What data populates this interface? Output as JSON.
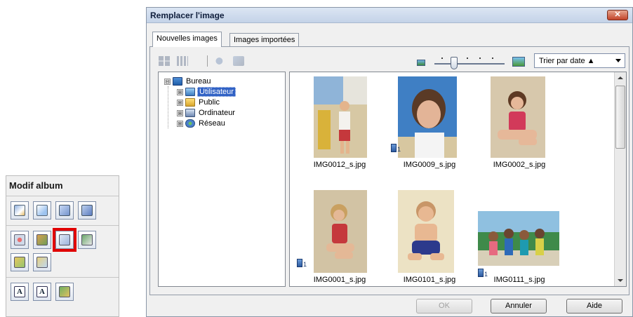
{
  "album_panel": {
    "title": "Modif album",
    "highlighted_button": "replace-image-button",
    "text_icons": [
      "A",
      "A"
    ]
  },
  "dialog": {
    "title": "Remplacer l'image",
    "close_glyph": "✕",
    "tabs": [
      {
        "label": "Nouvelles images",
        "active": true
      },
      {
        "label": "Images importées",
        "active": false
      }
    ],
    "sort": {
      "value": "Trier par date ▲"
    },
    "zoom_level_fraction": 0.25,
    "tree": [
      {
        "label": "Bureau",
        "icon": "desktop-icon",
        "expander": "⊟",
        "selected": false,
        "level": 0
      },
      {
        "label": "Utilisateur",
        "icon": "user-folder-icon",
        "expander": "⊞",
        "selected": true,
        "level": 1
      },
      {
        "label": "Public",
        "icon": "public-folder-icon",
        "expander": "⊞",
        "selected": false,
        "level": 1
      },
      {
        "label": "Ordinateur",
        "icon": "computer-icon",
        "expander": "⊞",
        "selected": false,
        "level": 1
      },
      {
        "label": "Réseau",
        "icon": "network-icon",
        "expander": "⊞",
        "selected": false,
        "level": 1
      }
    ],
    "thumbnails": [
      {
        "filename": "IMG0012_s.jpg",
        "count": ""
      },
      {
        "filename": "IMG0009_s.jpg",
        "count": "1"
      },
      {
        "filename": "IMG0002_s.jpg",
        "count": ""
      },
      {
        "filename": "IMG0001_s.jpg",
        "count": "1"
      },
      {
        "filename": "IMG0101_s.jpg",
        "count": ""
      },
      {
        "filename": "IMG0111_s.jpg",
        "count": "1"
      }
    ],
    "buttons": {
      "ok": "OK",
      "cancel": "Annuler",
      "help": "Aide"
    }
  },
  "colors": {
    "highlight": "#e00000",
    "selection": "#3162c5"
  }
}
